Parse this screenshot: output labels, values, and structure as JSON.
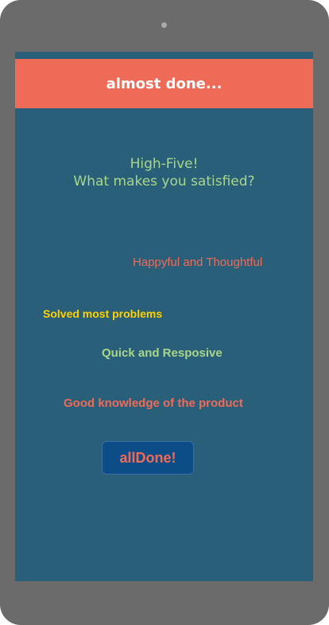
{
  "header": {
    "title": "almost done..."
  },
  "question": {
    "line1": "High-Five!",
    "line2": "What makes you satisfied?"
  },
  "options": [
    {
      "label": "Happyful and Thoughtful",
      "color": "#ee6b58"
    },
    {
      "label": "Solved most problems",
      "color": "#ffd000"
    },
    {
      "label": "Quick and Resposive",
      "color": "#a8d68a"
    },
    {
      "label": "Good knowledge of the product",
      "color": "#ee6b58"
    }
  ],
  "done_button": {
    "label": "allDone!"
  },
  "colors": {
    "device_frame": "#6b6b6b",
    "screen_bg": "#2a5f7a",
    "header_bg": "#ee6b58",
    "button_bg": "#0c4c87",
    "accent_green": "#a8d68a"
  }
}
